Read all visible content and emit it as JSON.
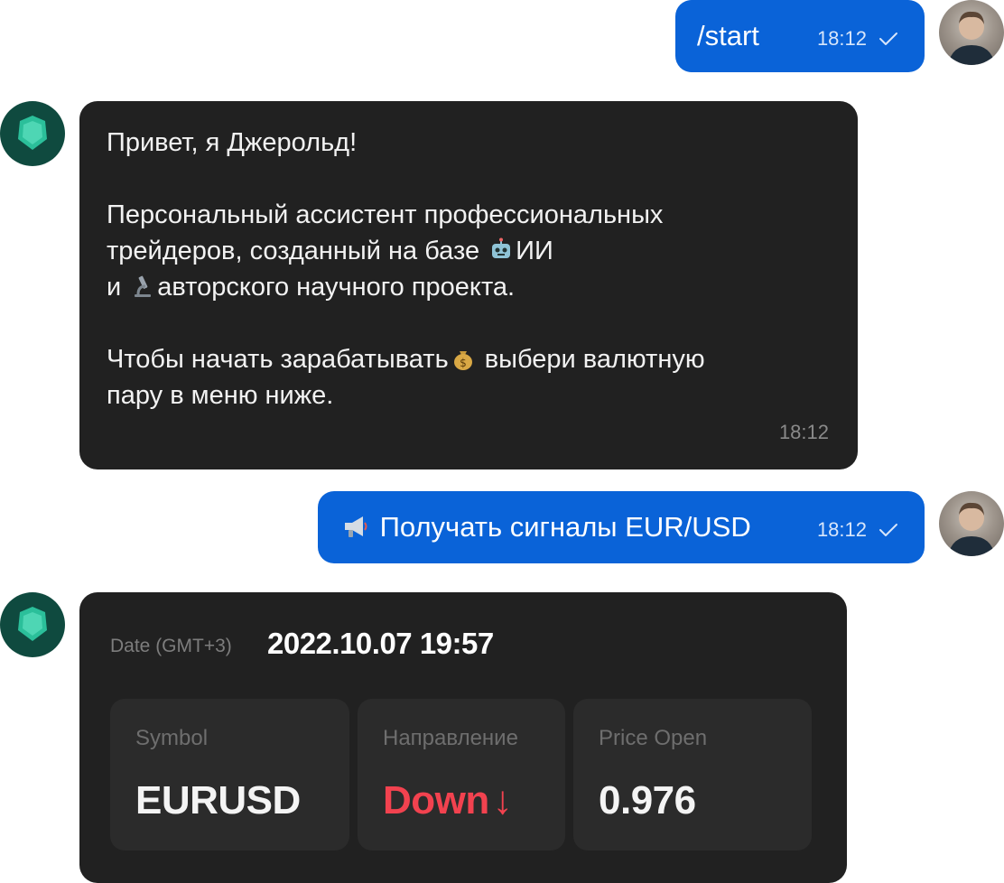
{
  "messages": [
    {
      "from": "user",
      "text": "/start",
      "time": "18:12"
    },
    {
      "from": "bot",
      "lines": [
        "Привет, я Джерольд!",
        "",
        "Персональный ассистент профессиональных",
        "трейдеров, созданный на базе ",
        "ИИ",
        "и ",
        "авторского научного проекта.",
        "",
        "Чтобы начать зарабатывать",
        " выбери валютную",
        "пару в меню ниже."
      ],
      "time": "18:12"
    },
    {
      "from": "user",
      "text": "Получать сигналы EUR/USD",
      "time": "18:12"
    }
  ],
  "signal": {
    "date_label": "Date (GMT+3)",
    "date_value": "2022.10.07 19:57",
    "cards": [
      {
        "label": "Symbol",
        "value": "EURUSD"
      },
      {
        "label": "Направление",
        "value": "Down",
        "arrow": "↓"
      },
      {
        "label": "Price Open",
        "value": "0.976"
      }
    ]
  },
  "icons": {
    "robot": "robot-emoji",
    "microscope": "microscope-emoji",
    "money": "money-bag-emoji",
    "megaphone": "megaphone-emoji",
    "check": "check-icon"
  },
  "colors": {
    "outgoing_bubble": "#0a63d8",
    "incoming_bubble": "#212121",
    "card_bg": "#2b2b2b",
    "down": "#f2424f"
  }
}
